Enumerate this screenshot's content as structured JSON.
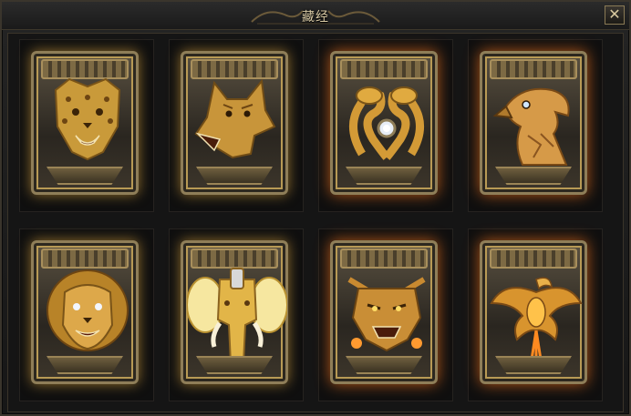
{
  "window": {
    "title": "藏经"
  },
  "colors": {
    "gold": "#e2b548",
    "gold_dark": "#8a6320",
    "frame": "#8f7e58",
    "background": "#151515",
    "fire": "#ff7a1e"
  },
  "cards": [
    {
      "icon": "leopard-icon",
      "effect": "glow"
    },
    {
      "icon": "wolf-icon",
      "effect": "glow"
    },
    {
      "icon": "twin-serpent-icon",
      "effect": "fire"
    },
    {
      "icon": "eagle-icon",
      "effect": "fire"
    },
    {
      "icon": "lion-icon",
      "effect": "glow"
    },
    {
      "icon": "elephant-icon",
      "effect": "glow"
    },
    {
      "icon": "dragon-icon",
      "effect": "fire"
    },
    {
      "icon": "phoenix-icon",
      "effect": "fire"
    }
  ]
}
